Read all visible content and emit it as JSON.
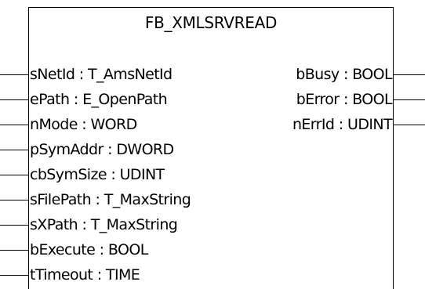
{
  "function_block": {
    "title": "FB_XMLSRVREAD",
    "inputs": [
      {
        "label": "sNetId : T_AmsNetId"
      },
      {
        "label": "ePath : E_OpenPath"
      },
      {
        "label": "nMode : WORD"
      },
      {
        "label": "pSymAddr : DWORD"
      },
      {
        "label": "cbSymSize : UDINT"
      },
      {
        "label": "sFilePath : T_MaxString"
      },
      {
        "label": "sXPath : T_MaxString"
      },
      {
        "label": "bExecute : BOOL"
      },
      {
        "label": "tTimeout : TIME"
      }
    ],
    "outputs": [
      {
        "label": "bBusy : BOOL"
      },
      {
        "label": "bError : BOOL"
      },
      {
        "label": "nErrId : UDINT"
      }
    ]
  }
}
